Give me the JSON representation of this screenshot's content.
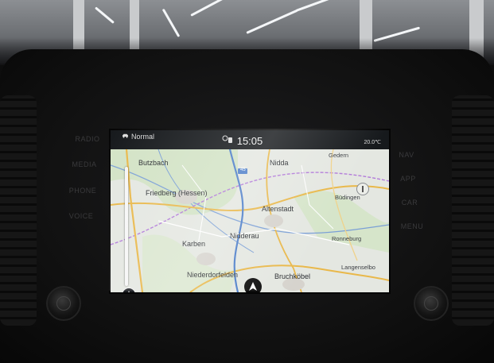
{
  "status_bar": {
    "mode": "Normal",
    "time": "15:05",
    "temperature": "20.0℃"
  },
  "map": {
    "places": {
      "butzbach": "Butzbach",
      "nidda": "Nidda",
      "gedern": "Gedern",
      "friedberg": "Friedberg (Hessen)",
      "altenstadt": "Altenstadt",
      "buedingen": "Büdingen",
      "nidderau": "Nidderau",
      "karben": "Karben",
      "ronneburg": "Ronneburg",
      "langenselbold": "Langenselbo",
      "niederdorfelden": "Niederdorfelden",
      "bruchkoebel": "Bruchköbel"
    },
    "road_shield": "45"
  },
  "hardware_buttons": {
    "left": [
      "RADIO",
      "MEDIA",
      "PHONE",
      "VOICE"
    ],
    "right": [
      "NAV",
      "APP",
      "CAR",
      "MENU"
    ]
  },
  "colors": {
    "map_background": "#dfe3dc",
    "road_major": "#e9b84a",
    "road_highway": "#4d7ec9",
    "water": "#7a9fd6",
    "border_purple": "#b27ad9",
    "forest": "#cfe0c2"
  },
  "icons": [
    "car-icon",
    "phone-icon",
    "north-arrow-icon",
    "compass-icon",
    "position-arrow-icon"
  ]
}
